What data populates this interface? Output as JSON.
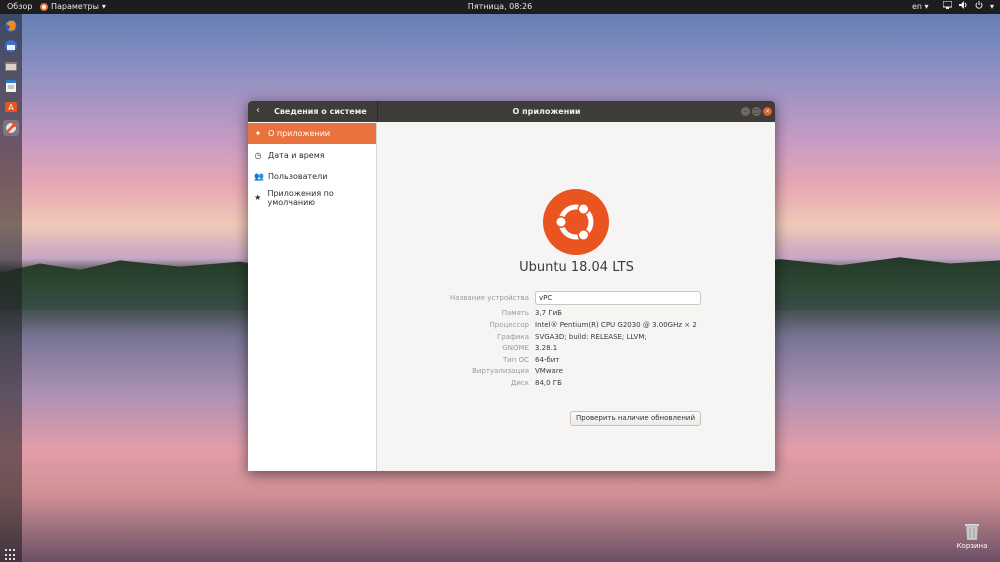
{
  "topbar": {
    "overview": "Обзор",
    "app_menu": "Параметры",
    "clock": "Пятница, 08:26",
    "lang": "en"
  },
  "dock": {
    "items": [
      "firefox-icon",
      "thunderbird-icon",
      "files-icon",
      "libreoffice-writer-icon",
      "software-center-icon",
      "settings-icon"
    ]
  },
  "window": {
    "left_title": "Сведения о системе",
    "center_title": "О приложении",
    "sidebar": [
      {
        "label": "О приложении",
        "icon": "sparkle-icon",
        "selected": true
      },
      {
        "label": "Дата и время",
        "icon": "clock-icon",
        "selected": false
      },
      {
        "label": "Пользователи",
        "icon": "users-icon",
        "selected": false
      },
      {
        "label": "Приложения по умолчанию",
        "icon": "star-icon",
        "selected": false
      }
    ],
    "about": {
      "os_name": "Ubuntu 18.04 LTS",
      "device_label": "Название устройства",
      "device_value": "vPC",
      "rows": [
        {
          "k": "Память",
          "v": "3,7 ГиБ"
        },
        {
          "k": "Процессор",
          "v": "Intel® Pentium(R) CPU G2030 @ 3.00GHz × 2"
        },
        {
          "k": "Графика",
          "v": "SVGA3D; build: RELEASE; LLVM;"
        },
        {
          "k": "GNOME",
          "v": "3.28.1"
        },
        {
          "k": "Тип ОС",
          "v": "64-бит"
        },
        {
          "k": "Виртуализация",
          "v": "VMware"
        },
        {
          "k": "Диск",
          "v": "84,0 ГБ"
        }
      ],
      "update_button": "Проверить наличие обновлений"
    }
  },
  "desktop": {
    "trash_label": "Корзина"
  },
  "colors": {
    "accent": "#e9733f",
    "ubuntu_orange": "#e95420",
    "titlebar": "#3e3c39"
  }
}
